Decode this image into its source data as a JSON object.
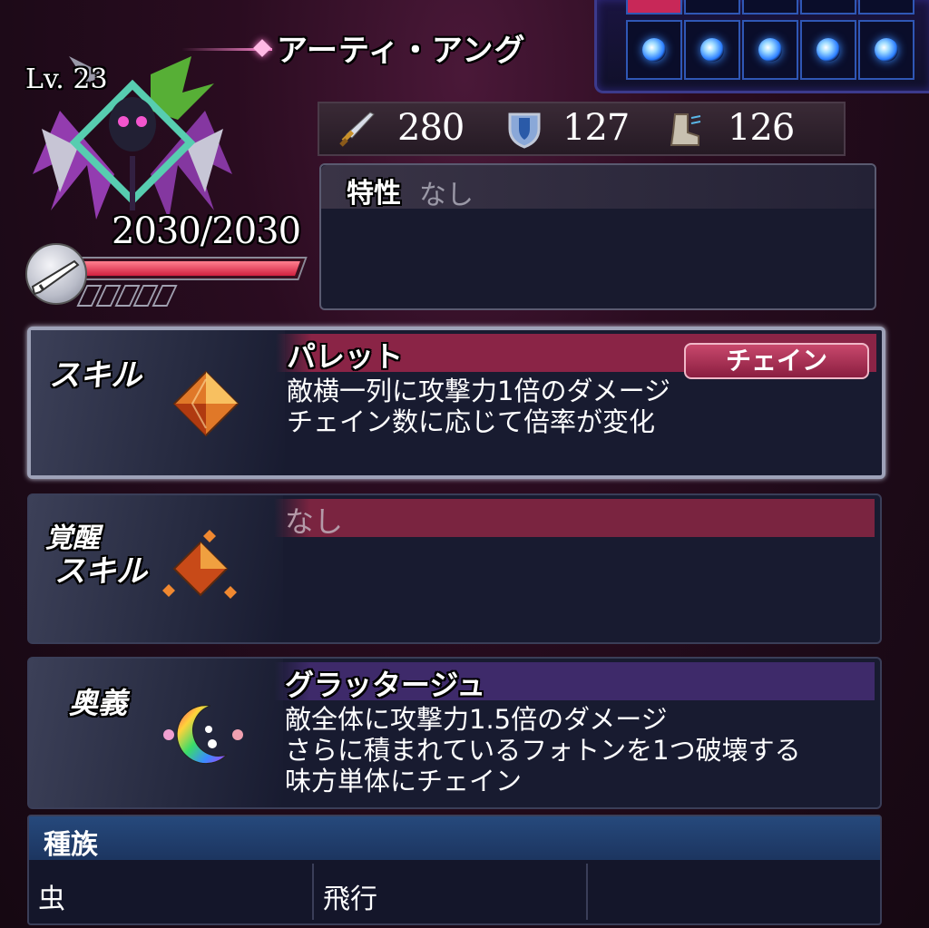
{
  "unit": {
    "name": "アーティ・アング",
    "level": "Lv. 23",
    "hp": "2030/2030",
    "hp_fraction": 1.0
  },
  "stats": {
    "attack": "280",
    "defense": "127",
    "speed": "126",
    "attack_icon": "sword-icon",
    "defense_icon": "shield-icon",
    "speed_icon": "boot-icon"
  },
  "orbs": {
    "count": 5,
    "color": "#3a8cff"
  },
  "trait": {
    "label": "特性",
    "value": "なし"
  },
  "skill": {
    "label": "スキル",
    "name": "パレット",
    "tag": "チェイン",
    "desc1": "敵横一列に攻撃力1倍のダメージ",
    "desc2": "チェイン数に応じて倍率が変化",
    "icon": "crystal-icon"
  },
  "awaken": {
    "label1": "覚醒",
    "label2": "スキル",
    "name": "なし",
    "icon": "crystal-cluster-icon"
  },
  "ougi": {
    "label": "奥義",
    "name": "グラッタージュ",
    "desc1": "敵全体に攻撃力1.5倍のダメージ",
    "desc2": "さらに積まれているフォトンを1つ破壊する",
    "desc3": "味方単体にチェイン",
    "icon": "rainbow-moon-icon"
  },
  "race": {
    "label": "種族",
    "values": [
      "虫",
      "飛行",
      ""
    ]
  },
  "colors": {
    "skill_header": "#8a2446",
    "ougi_header": "#3e2a6a",
    "race_header": "#26497c"
  }
}
